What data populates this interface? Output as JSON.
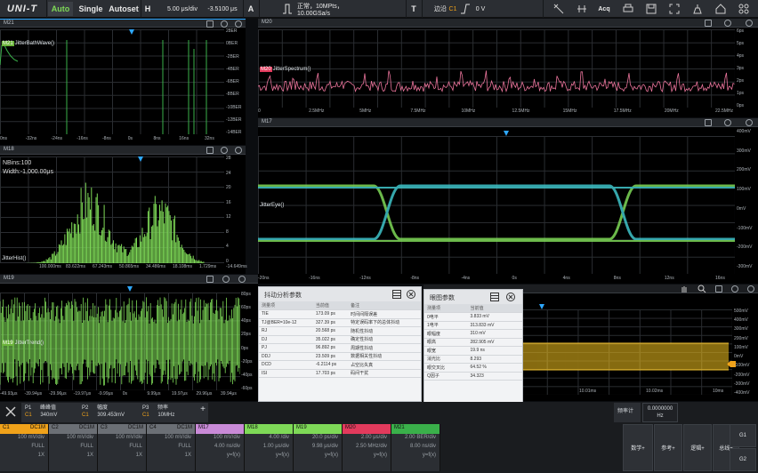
{
  "topbar": {
    "logo": "UNI-T",
    "auto": "Auto",
    "single": "Single",
    "autoset": "Autoset",
    "h": "H",
    "timebase": "5.00 μs/div",
    "hpos": "-3.5100 μs",
    "a": "A",
    "acq_status": "正常，10MPts，10.00GSa/s",
    "t": "T",
    "trig_edge": "边沿",
    "trig_src": "C1",
    "trig_level": "0 V",
    "acq": "Acq"
  },
  "m21": {
    "name": "M21",
    "label": "JitterBathWave()",
    "yticks": [
      "28ER",
      "0BER",
      "-2BER",
      "-4BER",
      "-6BER",
      "-8BER",
      "-10BER",
      "-12BER",
      "-14BER"
    ],
    "xticks": [
      "0ns",
      "-32ns",
      "-24ns",
      "-16ns",
      "-8ns",
      "0s",
      "8ns",
      "16ns",
      "32ns"
    ]
  },
  "m20": {
    "name": "M20",
    "label": "JitterSpectrum()",
    "yticks": [
      "6ps",
      "5ps",
      "4ps",
      "3ps",
      "2ps",
      "1ps",
      "0ps"
    ],
    "xticks": [
      "0",
      "2.5MHz",
      "5MHz",
      "7.5MHz",
      "10MHz",
      "12.5MHz",
      "15MHz",
      "17.5MHz",
      "20MHz",
      "22.5MHz"
    ]
  },
  "m18": {
    "name": "M18",
    "nbins": "NBins:100",
    "width": "Width:-1,000.00μs",
    "label": "JitterHist()",
    "yticks": [
      "28",
      "24",
      "20",
      "16",
      "12",
      "8",
      "4",
      "0"
    ],
    "xticks": [
      "100.000ms",
      "83.622ms",
      "67.243ms",
      "50.865ms",
      "34.486ms",
      "18.108ms",
      "1.729ms",
      "-14.649ms"
    ]
  },
  "m17": {
    "name": "M17",
    "label": "JitterEye()",
    "yticks": [
      "400mV",
      "300mV",
      "200mV",
      "100mV",
      "0mV",
      "-100mV",
      "-200mV",
      "-300mV"
    ],
    "xticks": [
      "-20ns",
      "-16ns",
      "-12ns",
      "-8ns",
      "-4ns",
      "0s",
      "4ns",
      "8ns",
      "12ns",
      "16ns"
    ]
  },
  "m19": {
    "name": "M19",
    "label": "JitterTrend()",
    "yticks": [
      "80ps",
      "60ps",
      "40ps",
      "20ps",
      "0ps",
      "-20ps",
      "-40ps",
      "-60ps"
    ],
    "xticks": [
      "-49.93μs",
      "-39.94μs",
      "-29.96μs",
      "-19.97μs",
      "-9.99μs",
      "0s",
      "9.99μs",
      "19.97μs",
      "29.96μs",
      "39.94μs"
    ]
  },
  "c1": {
    "yticks": [
      "500mV",
      "400mV",
      "300mV",
      "200mV",
      "100mV",
      "0mV",
      "-100mV",
      "-200mV",
      "-300mV",
      "-400mV"
    ],
    "xticks": [
      "10ns",
      "10.01ms",
      "10.02ms",
      "10ms"
    ]
  },
  "jitter_dlg": {
    "title": "抖动分析参数",
    "headers": [
      "测量项",
      "当前值",
      "备注"
    ],
    "rows": [
      [
        "TIE",
        "173.09 ps",
        "时间间隔误差"
      ],
      [
        "TJ@BER=10e-12",
        "327.39 ps",
        "特定误码率下的总体抖动"
      ],
      [
        "RJ",
        "20.568 ps",
        "随机性抖动"
      ],
      [
        "DJ",
        "35.022 ps",
        "确定性抖动"
      ],
      [
        "PJ",
        "96.892 ps",
        "周期性抖动"
      ],
      [
        "DDJ",
        "23.509 ps",
        "数据相关性抖动"
      ],
      [
        "DCD",
        "-6.2114 ps",
        "占空比失真"
      ],
      [
        "ISI",
        "17.703 ps",
        "码间干扰"
      ]
    ]
  },
  "eye_dlg": {
    "title": "眼图参数",
    "headers": [
      "测量项",
      "当前值"
    ],
    "rows": [
      [
        "0电平",
        "3.833 mV"
      ],
      [
        "1电平",
        "313.833 mV"
      ],
      [
        "眼幅度",
        "310 mV"
      ],
      [
        "眼高",
        "282.905 mV"
      ],
      [
        "眼宽",
        "19.9 ns"
      ],
      [
        "消光比",
        "8.293"
      ],
      [
        "眼交叉比",
        "64.52 %"
      ],
      [
        "Q因子",
        "34.323"
      ]
    ]
  },
  "meas": [
    {
      "k": "P1",
      "c": "C1",
      "n": "峰峰值",
      "v": "340mV"
    },
    {
      "k": "P2",
      "c": "C1",
      "n": "幅度",
      "v": "309.453mV"
    },
    {
      "k": "P3",
      "c": "C1",
      "n": "频率",
      "v": "10MHz"
    }
  ],
  "freq": {
    "label": "频率计",
    "value": "0.0000000",
    "unit": "Hz"
  },
  "channels": [
    {
      "n": "C1",
      "t": "DC1M",
      "a": "100 mV/div",
      "b": "FULL",
      "c": "1X"
    },
    {
      "n": "C2",
      "t": "DC1M",
      "a": "100 mV/div",
      "b": "FULL",
      "c": "1X"
    },
    {
      "n": "C3",
      "t": "DC1M",
      "a": "100 mV/div",
      "b": "FULL",
      "c": "1X"
    },
    {
      "n": "C4",
      "t": "DC1M",
      "a": "100 mV/div",
      "b": "FULL",
      "c": "1X"
    },
    {
      "n": "M17",
      "t": "",
      "a": "100 mV/div",
      "b": "4.00 ns/div",
      "c": "y=f(x)"
    },
    {
      "n": "M18",
      "t": "",
      "a": "4.00 /div",
      "b": "1.00 μs/div",
      "c": "y=f(x)"
    },
    {
      "n": "M19",
      "t": "",
      "a": "20.0 ps/div",
      "b": "9.98 μs/div",
      "c": "y=f(x)"
    },
    {
      "n": "M20",
      "t": "",
      "a": "2.00 μs/div",
      "b": "2.50 MHz/div",
      "c": "y=f(x)"
    },
    {
      "n": "M21",
      "t": "",
      "a": "2.00 BER/div",
      "b": "8.00 ns/div",
      "c": "y=f(x)"
    }
  ],
  "right": {
    "math": "数学+",
    "ref": "参考+",
    "logic": "逻辑+",
    "bus": "总线+",
    "g1": "G1",
    "g2": "G2"
  },
  "colors": {
    "c1": "#f0a21a",
    "green": "#7ed957",
    "pink": "#e8739a",
    "cyan": "#3fc4c9",
    "m20": "#e23a5c",
    "m21": "#3ab04a"
  }
}
